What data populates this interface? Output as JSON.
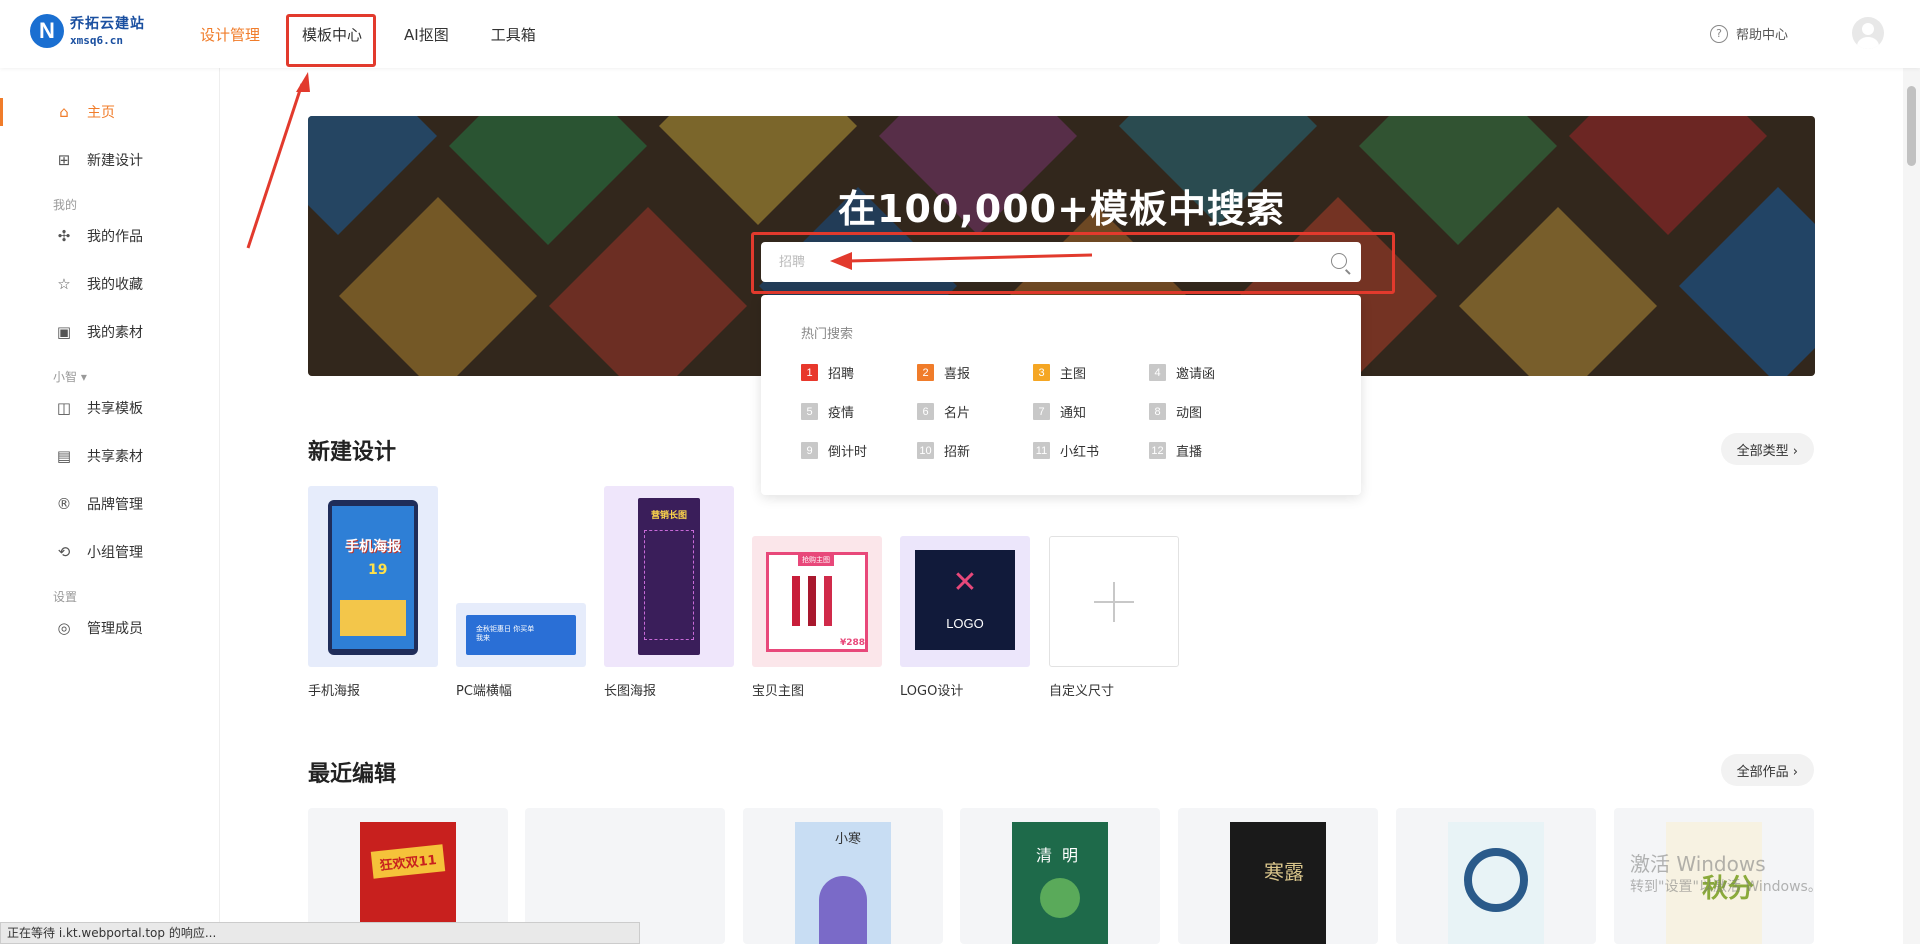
{
  "header": {
    "logo_name": "乔拓云建站",
    "logo_domain": "xmsq6.cn",
    "nav": [
      "设计管理",
      "模板中心",
      "AI抠图",
      "工具箱"
    ],
    "help": "帮助中心"
  },
  "sidebar": {
    "home": "主页",
    "new_design": "新建设计",
    "group_mine": "我的",
    "my_works": "我的作品",
    "my_favorites": "我的收藏",
    "my_materials": "我的素材",
    "group_team": "小智",
    "shared_templates": "共享模板",
    "shared_materials": "共享素材",
    "brand": "品牌管理",
    "team": "小组管理",
    "group_settings": "设置",
    "members": "管理成员"
  },
  "banner": {
    "title": "在100,000+模板中搜索",
    "search_placeholder": "招聘"
  },
  "hot": {
    "title": "热门搜索",
    "items": [
      {
        "num": "1",
        "label": "招聘",
        "color": "#e8382c"
      },
      {
        "num": "2",
        "label": "喜报",
        "color": "#f07c2a"
      },
      {
        "num": "3",
        "label": "主图",
        "color": "#f5a623"
      },
      {
        "num": "4",
        "label": "邀请函",
        "color": "#c8c8c8"
      },
      {
        "num": "5",
        "label": "疫情",
        "color": "#c8c8c8"
      },
      {
        "num": "6",
        "label": "名片",
        "color": "#c8c8c8"
      },
      {
        "num": "7",
        "label": "通知",
        "color": "#c8c8c8"
      },
      {
        "num": "8",
        "label": "动图",
        "color": "#c8c8c8"
      },
      {
        "num": "9",
        "label": "倒计时",
        "color": "#c8c8c8"
      },
      {
        "num": "10",
        "label": "招新",
        "color": "#c8c8c8"
      },
      {
        "num": "11",
        "label": "小红书",
        "color": "#c8c8c8"
      },
      {
        "num": "12",
        "label": "直播",
        "color": "#c8c8c8"
      }
    ]
  },
  "new_design": {
    "title": "新建设计",
    "all_types": "全部类型 ›",
    "cards": [
      "手机海报",
      "PC端横幅",
      "长图海报",
      "宝贝主图",
      "LOGO设计",
      "自定义尺寸"
    ],
    "thumb_texts": {
      "poster_title": "手机海报",
      "poster_price": "19",
      "banner_text": "金秋钜惠日 你买单我来",
      "long_title": "营销长图",
      "product_tag": "抢购主图",
      "product_price": "¥288",
      "logo_text": "LOGO"
    }
  },
  "recent": {
    "title": "最近编辑",
    "all_works": "全部作品 ›",
    "thumb_texts": [
      "狂欢双11",
      "小寒",
      "清明",
      "寒露",
      "秋分"
    ]
  },
  "status_bar": "正在等待 i.kt.webportal.top 的响应...",
  "watermark": {
    "line1": "激活 Windows",
    "line2": "转到\"设置\"以激活 Windows。"
  }
}
